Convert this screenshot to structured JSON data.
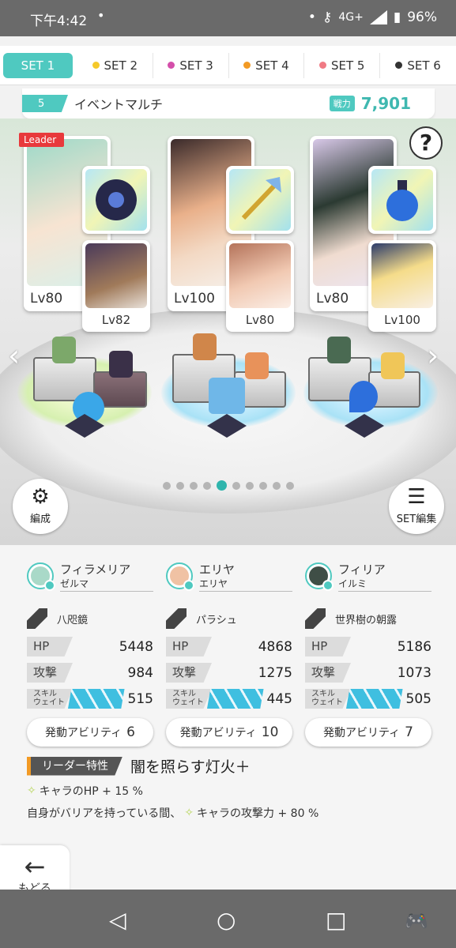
{
  "status": {
    "time": "下午4:42",
    "network": "4G+",
    "battery": "96%"
  },
  "tabs": [
    {
      "label": "SET 1",
      "color": ""
    },
    {
      "label": "SET 2",
      "color": "#f5c92a"
    },
    {
      "label": "SET 3",
      "color": "#d44faa"
    },
    {
      "label": "SET 4",
      "color": "#f29a24"
    },
    {
      "label": "SET 5",
      "color": "#f07a84"
    },
    {
      "label": "SET 6",
      "color": "#333333"
    }
  ],
  "party": {
    "number": "5",
    "name": "イベントマルチ",
    "power_label": "戦力",
    "power_value": "7,901"
  },
  "units": [
    {
      "main_level": "Lv80",
      "sub_level": "Lv82",
      "leader_tag": "Leader"
    },
    {
      "main_level": "Lv100",
      "sub_level": "Lv80"
    },
    {
      "main_level": "Lv80",
      "sub_level": "Lv100"
    }
  ],
  "buttons": {
    "formation": "編成",
    "set_edit": "SET編集",
    "back": "もどる"
  },
  "pager": {
    "total": 10,
    "active": 5
  },
  "members": [
    {
      "name": "フィラメリア",
      "sub": "ゼルマ",
      "weapon": "八咫鏡",
      "hp": "5448",
      "atk": "984",
      "wait": "515",
      "ability_label": "発動アビリティ",
      "ability_count": "6"
    },
    {
      "name": "エリヤ",
      "sub": "エリヤ",
      "weapon": "パラシュ",
      "hp": "4868",
      "atk": "1275",
      "wait": "445",
      "ability_label": "発動アビリティ",
      "ability_count": "10"
    },
    {
      "name": "フィリア",
      "sub": "イルミ",
      "weapon": "世界樹の朝露",
      "hp": "5186",
      "atk": "1073",
      "wait": "505",
      "ability_label": "発動アビリティ",
      "ability_count": "7"
    }
  ],
  "stat_labels": {
    "hp": "HP",
    "atk": "攻撃",
    "wait_1": "スキル",
    "wait_2": "ウェイト"
  },
  "leader": {
    "tag": "リーダー特性",
    "name": "闇を照らす灯火＋",
    "line1": "キャラのHP + 15 %",
    "line2_prefix": "自身がバリアを持っている間、",
    "line2_suffix": "キャラの攻撃力 + 80 %"
  },
  "colors": {
    "accent": "#4fc9c0",
    "power": "#3fb8b0",
    "leader_red": "#e8393c"
  },
  "icons": [
    "help-icon",
    "formation-icon",
    "set-edit-icon",
    "back-arrow-icon",
    "weapon-icon",
    "nav-back-icon",
    "nav-home-icon",
    "nav-recents-icon",
    "gamepad-icon"
  ]
}
